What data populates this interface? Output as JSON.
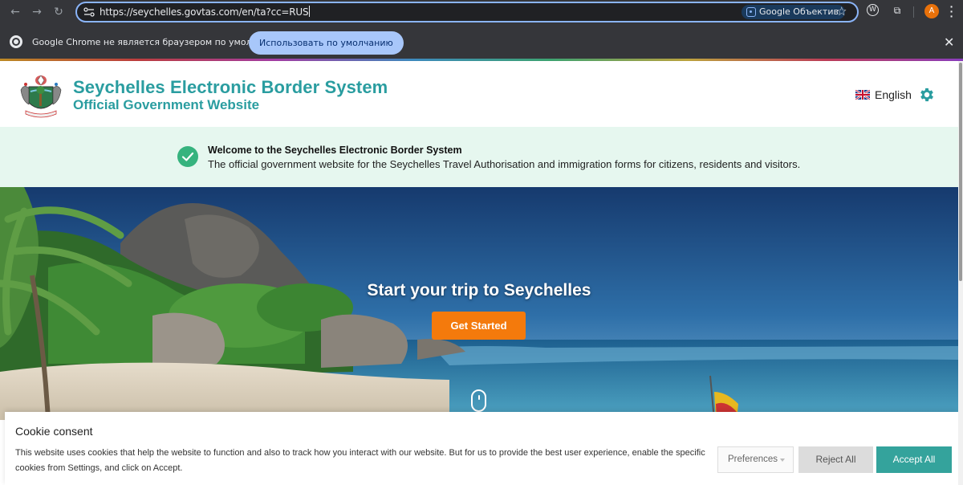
{
  "browser": {
    "url": "https://seychelles.govtas.com/en/ta?cc=RUS",
    "lens_label": "Google Объектив",
    "avatar_letter": "A",
    "infobar_text": "Google Chrome не является браузером по умолчанию.",
    "infobar_button": "Использовать по умолчанию"
  },
  "header": {
    "title": "Seychelles Electronic Border System",
    "subtitle": "Official Government Website",
    "language": "English"
  },
  "banner": {
    "title": "Welcome to the Seychelles Electronic Border System",
    "text": "The official government website for the Seychelles Travel Authorisation and immigration forms for citizens, residents and visitors."
  },
  "hero": {
    "title": "Start your trip to Seychelles",
    "cta": "Get Started"
  },
  "cookie": {
    "title": "Cookie consent",
    "text": "This website uses cookies that help the website to function and also to track how you interact with our website. But for us to provide the best user experience, enable the specific cookies from Settings, and click on Accept.",
    "preferences": "Preferences",
    "reject": "Reject All",
    "accept": "Accept All"
  },
  "colors": {
    "brand": "#2a9da0",
    "banner_bg": "#e6f7ef",
    "success": "#36b37e",
    "cta": "#f47a0c",
    "accept": "#34a39c"
  }
}
